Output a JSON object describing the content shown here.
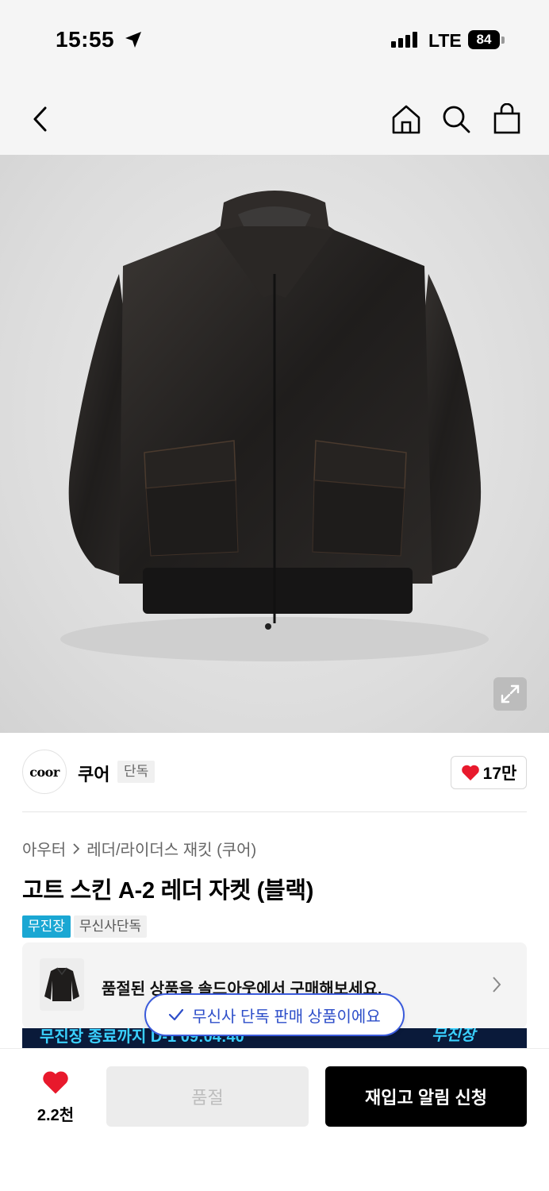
{
  "status_bar": {
    "time": "15:55",
    "network": "LTE",
    "battery": "84"
  },
  "nav": {
    "back_icon": "chevron-left-icon",
    "home_icon": "home-icon",
    "search_icon": "search-icon",
    "bag_icon": "shopping-bag-icon"
  },
  "product_image": {
    "subject": "black leather A-2 jacket",
    "expand_icon": "expand-icon"
  },
  "brand": {
    "logo_text": "coor",
    "name": "쿠어",
    "tag": "단독",
    "likes": "17만"
  },
  "breadcrumb": {
    "category": "아우터",
    "subcategory": "레더/라이더스 재킷 (쿠어)"
  },
  "product": {
    "title": "고트 스킨 A-2 레더 자켓 (블랙)",
    "badges": [
      "무진장",
      "무신사단독"
    ]
  },
  "soldout_card": {
    "text": "품절된 상품을 솔드아웃에서 구매해보세요."
  },
  "promo_banner": {
    "left_text": "무진장 종료까지 D-1 09:04:40",
    "right_text": "무진장"
  },
  "toast": {
    "text": "무신사 단독 판매 상품이에요"
  },
  "bottom_bar": {
    "wish_count": "2.2천",
    "soldout_label": "품절",
    "restock_label": "재입고 알림 신청"
  },
  "colors": {
    "accent_blue": "#1aa7d3",
    "toast_blue": "#2d4ec9",
    "heart_red": "#e8192c"
  }
}
